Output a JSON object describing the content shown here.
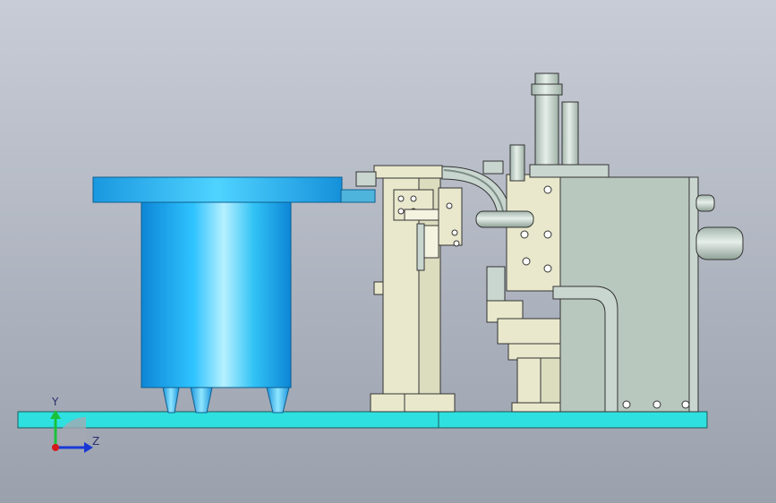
{
  "viewport": {
    "background_top": "#c8ccd6",
    "background_bottom": "#9aa1ad"
  },
  "axis_triad": {
    "y_label": "Y",
    "z_label": "Z",
    "y_color": "#19c23a",
    "z_color": "#1b38d6",
    "origin_color": "#d61a1a"
  },
  "colors": {
    "bowl": "#1ab8f0",
    "base_plate": "#2fe0e0",
    "frame_cream": "#e9e8cc",
    "machine_gray": "#b9c8be",
    "cylinder_gray": "#bccbc3"
  }
}
